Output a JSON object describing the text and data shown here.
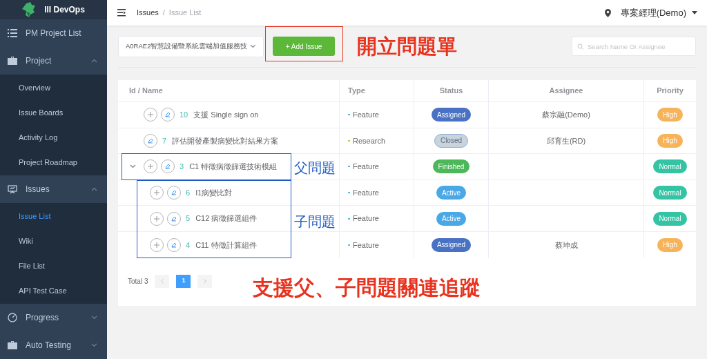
{
  "sidebar": {
    "logo": "III DevOps",
    "items": [
      {
        "label": "PM Project List",
        "expanded": false
      },
      {
        "label": "Project",
        "expanded": true,
        "children": [
          {
            "label": "Overview",
            "selected": false
          },
          {
            "label": "Issue Boards",
            "selected": false
          },
          {
            "label": "Activity Log",
            "selected": false
          },
          {
            "label": "Project Roadmap",
            "selected": false
          }
        ]
      },
      {
        "label": "Issues",
        "expanded": true,
        "children": [
          {
            "label": "Issue List",
            "selected": true
          },
          {
            "label": "Wiki",
            "selected": false
          },
          {
            "label": "File List",
            "selected": false
          },
          {
            "label": "API Test Case",
            "selected": false
          }
        ]
      },
      {
        "label": "Progress",
        "expanded": false
      },
      {
        "label": "Auto Testing",
        "expanded": false
      }
    ]
  },
  "header": {
    "breadcrumb": [
      "Issues",
      "/",
      "Issue List"
    ],
    "user": "專案經理(Demo)"
  },
  "toolbar": {
    "project": "A0RAE2智慧設備暨系統雲端加值服務技",
    "add_button": "+ Add Issue",
    "search": {
      "placeholder": "Search Name Or Assignee"
    }
  },
  "table": {
    "columns": [
      "Id / Name",
      "Type",
      "Status",
      "Assignee",
      "Priority"
    ],
    "rows": [
      {
        "id": "10",
        "name": "支援 Single sign on",
        "add_button": true,
        "type": {
          "label": "Feature",
          "color": "#4fc0e0"
        },
        "status": {
          "label": "Assigned",
          "color": "#4a72c4"
        },
        "assignee": "蔡宗融(Demo)",
        "priority": {
          "label": "High",
          "color": "#f7b35a"
        }
      },
      {
        "id": "7",
        "name": "評估開發產製病變比對結果方案",
        "add_button": false,
        "type": {
          "label": "Research",
          "color": "#b5d334"
        },
        "status": {
          "label": "Closed",
          "color": "#c8d3dc"
        },
        "assignee": "邱育生(RD)",
        "priority": {
          "label": "High",
          "color": "#f7b35a"
        }
      },
      {
        "id": "3",
        "name": "C1 特徵病徵篩選技術模組",
        "add_button": true,
        "expanded": true,
        "type": {
          "label": "Feature",
          "color": "#4fc0e0"
        },
        "status": {
          "label": "Finished",
          "color": "#4cb85a"
        },
        "priority": {
          "label": "Normal",
          "color": "#34c4a4"
        },
        "children": [
          {
            "id": "6",
            "name": "I1病變比對",
            "add_button": true,
            "type": {
              "label": "Feature",
              "color": "#4fc0e0"
            },
            "status": {
              "label": "Active",
              "color": "#4aa8e6"
            },
            "priority": {
              "label": "Normal",
              "color": "#34c4a4"
            }
          },
          {
            "id": "5",
            "name": "C12 病徵篩選組件",
            "add_button": true,
            "type": {
              "label": "Feature",
              "color": "#4fc0e0"
            },
            "status": {
              "label": "Active",
              "color": "#4aa8e6"
            },
            "priority": {
              "label": "Normal",
              "color": "#34c4a4"
            }
          },
          {
            "id": "4",
            "name": "C11 特徵計算組件",
            "add_button": true,
            "type": {
              "label": "Feature",
              "color": "#4fc0e0"
            },
            "status": {
              "label": "Assigned",
              "color": "#4a72c4"
            },
            "assignee": "蔡坤成",
            "priority": {
              "label": "High",
              "color": "#f7b35a"
            }
          }
        ]
      }
    ]
  },
  "pagination": {
    "total": "Total 3",
    "pages": [
      {
        "label": "1",
        "selected": true
      }
    ]
  },
  "annotations": [
    {
      "text": "開立問題單",
      "color": "#e8321e"
    },
    {
      "text": "父問題",
      "color": "#1f5bc4"
    },
    {
      "text": "子問題",
      "color": "#1f5bc4"
    },
    {
      "text": "支援父、子問題關連追蹤",
      "color": "#e8321e"
    }
  ]
}
